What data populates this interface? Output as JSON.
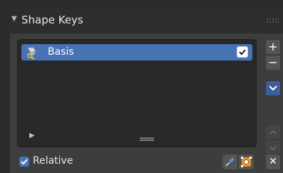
{
  "panel": {
    "title": "Shape Keys",
    "collapse_icon": "triangle-down-icon",
    "drag_icon": "grip-dots-icon"
  },
  "list": {
    "items": [
      {
        "label": "Basis",
        "icon": "shape-key-icon",
        "checked": true,
        "selected": true
      }
    ],
    "filter_icon": "triangle-right-icon",
    "resize_icon": "resize-grip-icon"
  },
  "side_buttons": {
    "add": "+",
    "remove": "−",
    "specials_icon": "chevron-down-icon",
    "move_up_icon": "arrow-up-icon",
    "move_down_icon": "arrow-down-icon"
  },
  "footer": {
    "relative_label": "Relative",
    "relative_checked": true,
    "pin_icon": "pin-icon",
    "edit_mode_icon": "edit-mode-icon",
    "clear_label": "✕"
  },
  "colors": {
    "selection": "#4772b3",
    "panel_bg": "#3d3d3d",
    "list_bg": "#282828",
    "button_bg": "#545454"
  }
}
